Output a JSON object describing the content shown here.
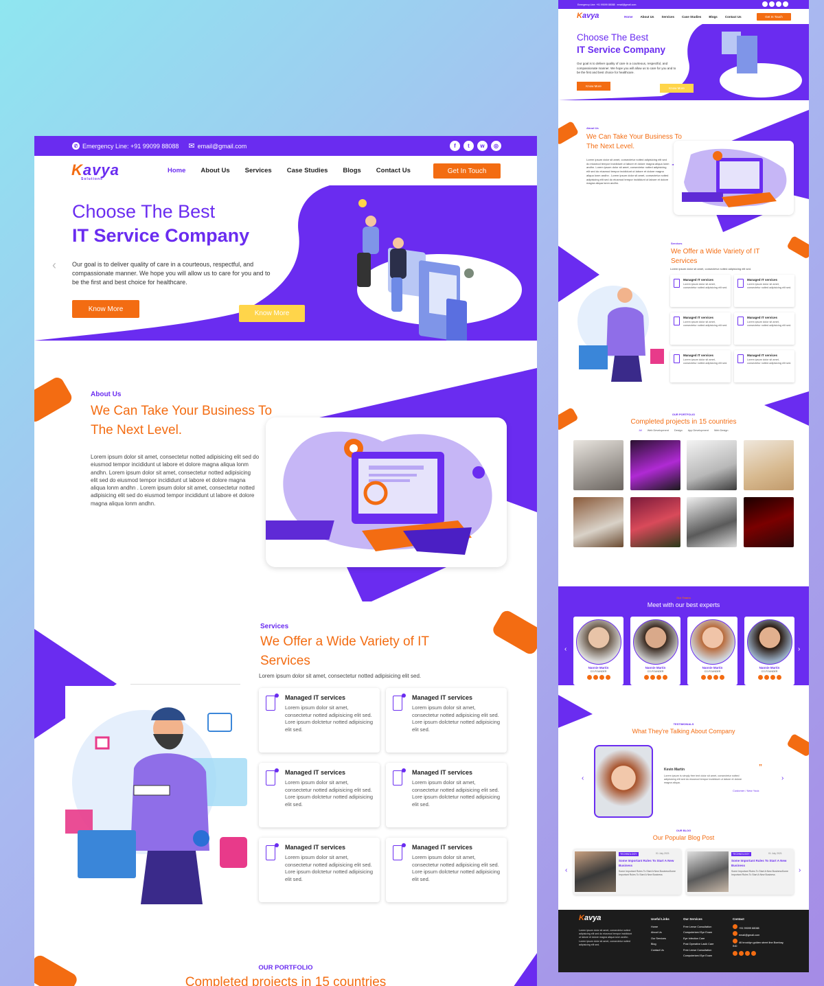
{
  "brand": {
    "name_k": "K",
    "name_rest": "avya",
    "tagline": "Solutions",
    "primary": "#6a2cf0",
    "accent": "#f36c12",
    "highlight": "#ffd54a"
  },
  "topbar": {
    "phone": "Emergency Line: +91 99099 88088",
    "email": "email@gmail.com",
    "social_icons": [
      "facebook-icon",
      "twitter-icon",
      "whatsapp-icon",
      "instagram-icon"
    ]
  },
  "nav": {
    "items": [
      "Home",
      "About Us",
      "Services",
      "Case Studies",
      "Blogs",
      "Contact Us"
    ],
    "active": "Home",
    "cta": "Get In Touch"
  },
  "hero": {
    "title_line1": "Choose The Best",
    "title_line2": "IT Service Company",
    "text": "Our goal is to deliver quality of care in a courteous, respectful, and compassionate manner. We hope you will allow us to care for you and to be the first and best choice for healthcare.",
    "primary_button": "Know More",
    "secondary_button": "Know More"
  },
  "about": {
    "label": "About Us",
    "heading": "We Can Take Your Business To The Next Level.",
    "text": "Lorem ipsum dolor sit amet, consectetur notted adipisicing elit sed do eiusmod tempor incididunt ut labore et dolore magna aliqua lonm andhn. Lorem ipsum dolor sit amet, consectetur notted adipisicing elit sed do eiusmod tempor incididunt ut labore et dolore magna aliqua lonm andhn . Lorem ipsum dolor sit amet, consectetur notted adipisicing elit sed do eiusmod tempor incididunt ut labore et dolore magna aliqua lonm andhn."
  },
  "services": {
    "label": "Services",
    "heading": "We Offer a Wide Variety of IT Services",
    "subtext": "Lorem ipsum dolor sit amet, consectetur notted adipisicing elit sed.",
    "items": [
      {
        "title": "Managed IT services",
        "text": "Lorem ipsum dolor sit amet, consectetur notted adipisicing elit sed.",
        "text2": "Lore ipsum dolctetur notted adipisicing elit sed."
      },
      {
        "title": "Managed IT services",
        "text": "Lorem ipsum dolor sit amet, consectetur notted adipisicing elit sed.",
        "text2": "Lore ipsum dolctetur notted adipisicing elit sed."
      },
      {
        "title": "Managed IT services",
        "text": "Lorem ipsum dolor sit amet, consectetur notted adipisicing elit sed.",
        "text2": "Lore ipsum dolctetur notted adipisicing elit sed."
      },
      {
        "title": "Managed IT services",
        "text": "Lorem ipsum dolor sit amet, consectetur notted adipisicing elit sed.",
        "text2": "Lore ipsum dolctetur notted adipisicing elit sed."
      },
      {
        "title": "Managed IT services",
        "text": "Lorem ipsum dolor sit amet, consectetur notted adipisicing elit sed.",
        "text2": "Lore ipsum dolctetur notted adipisicing elit sed."
      },
      {
        "title": "Managed IT services",
        "text": "Lorem ipsum dolor sit amet, consectetur notted adipisicing elit sed.",
        "text2": "Lore ipsum dolctetur notted adipisicing elit sed."
      }
    ]
  },
  "portfolio": {
    "label": "OUR PORTFOLIO",
    "heading": "Completed projects in 15 countries",
    "tabs": [
      "All",
      "Web Development",
      "Design",
      "App Development",
      "Web Design"
    ],
    "active_tab": "All"
  },
  "team": {
    "label": "Our Teams",
    "heading": "Meet with our best experts",
    "members": [
      {
        "name": "Nannie Martin",
        "role": "CO-FOUNDER"
      },
      {
        "name": "Nannie Martin",
        "role": "CO-FOUNDER"
      },
      {
        "name": "Nannie Martin",
        "role": "CO-FOUNDER"
      },
      {
        "name": "Nannie Martin",
        "role": "CO-FOUNDER"
      }
    ]
  },
  "testimonials": {
    "label": "TESTIMONIALS",
    "heading": "What They're Talking About Company",
    "name": "Kevin Martin",
    "text": "Lorem ipsum is simply free text dolor sit amet, consectetur notted adipisicing elit sed do eiusmod tempor incididunt ut labore et dolore magna aliqua.",
    "role": "Customer / New Youk"
  },
  "blog": {
    "label": "OUR BLOG",
    "heading": "Our Popular Blog Post",
    "posts": [
      {
        "tag": "TECHNOLOGY",
        "date": "01 July 2021",
        "title": "Some Important Rules To Start A New Business",
        "text": "Some Important Rules To Start A New BusinessSome Important Rules To Start A New Business"
      },
      {
        "tag": "TECHNOLOGY",
        "date": "01 July 2021",
        "title": "Some Important Rules To Start A New Business",
        "text": "Some Important Rules To Start A New BusinessSome Important Rules To Start A New Business"
      }
    ]
  },
  "footer": {
    "about": "Lorem ipsum dolor sit amet, consectetur notted adipisicing elit sed do eiusmod tempor incididunt ut labore et dolore magna aliqua lonm andhn. Lorem ipsum dolor sit amet, consectetur notted adipisicing elit sed.",
    "useful_links_title": "Useful Links",
    "useful_links": [
      "Home",
      "About Us",
      "Our Services",
      "Blog",
      "Contact Us"
    ],
    "services_title": "Our Services",
    "services": [
      "Free Lense Consultation",
      "Computerized Eye Exam",
      "Eye Infection Care",
      "Post Operative Lasik Care",
      "Free Lense Consultation",
      "Computerized Eye Exam"
    ],
    "contact_title": "Contact",
    "phone": "+91 99099 88088",
    "email": "email@gmail.com",
    "address": "46 brooklyn golden street line Bombay, IND"
  }
}
